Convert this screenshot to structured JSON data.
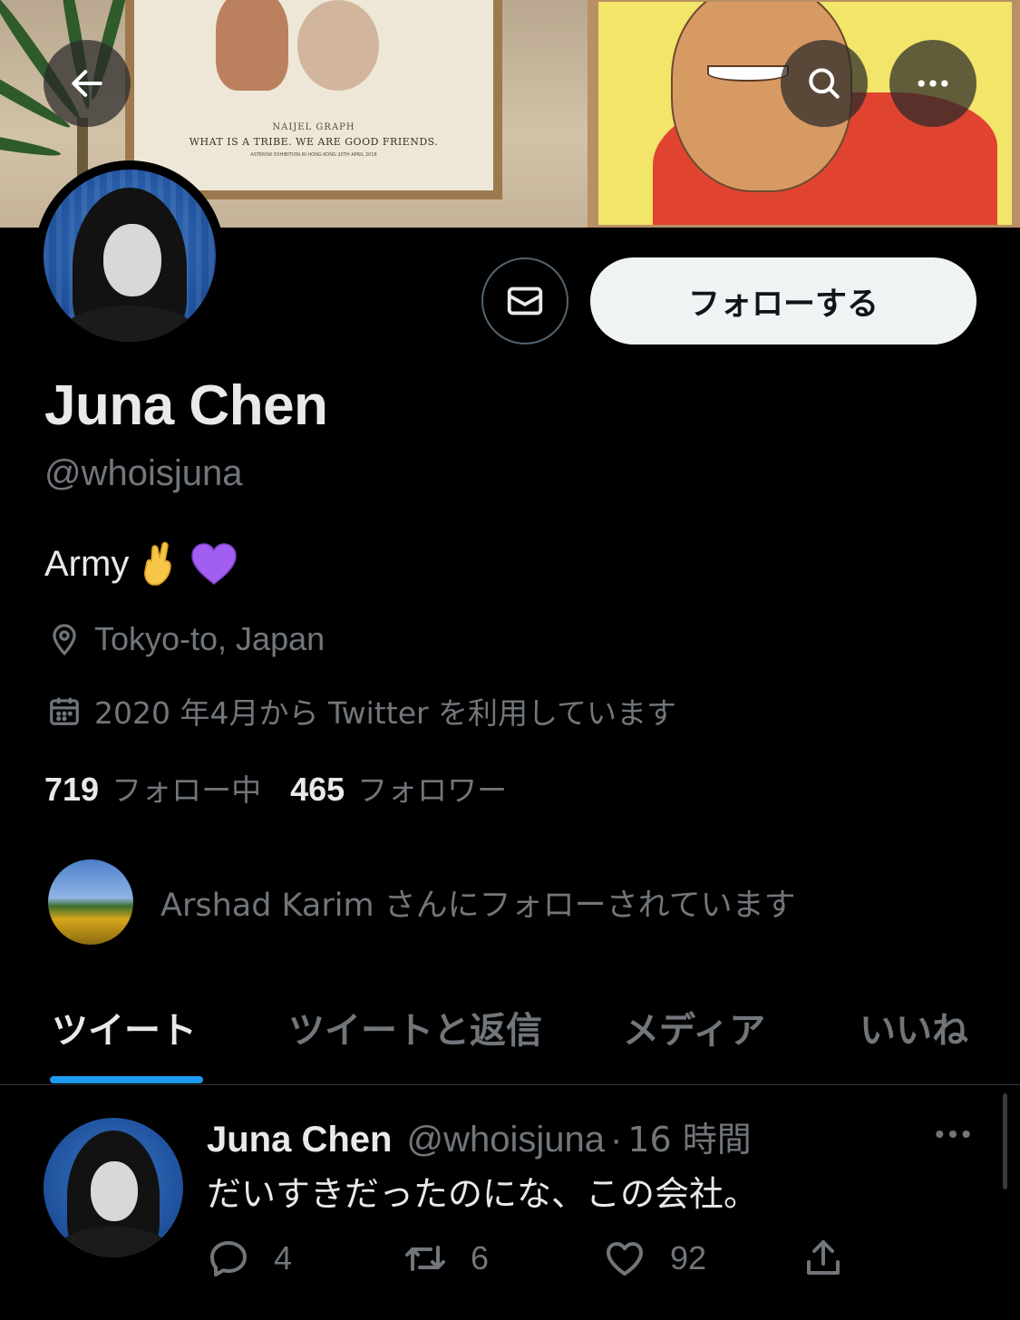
{
  "banner": {
    "artwork_caption_1": "NAIJEL GRAPH",
    "artwork_caption_2": "WHAT IS A TRIBE. WE ARE GOOD FRIENDS.",
    "artwork_caption_3": "ASTERISK EXHIBITION IN HONG KONG 20TH APRIL 2018"
  },
  "profile": {
    "name": "Juna Chen",
    "handle": "@whoisjuna",
    "bio_text": "Army",
    "location": "Tokyo-to, Japan",
    "joined": "2020 年4月から Twitter を利用しています",
    "following_count": "719",
    "following_label": "フォロー中",
    "followers_count": "465",
    "followers_label": "フォロワー",
    "followed_by": "Arshad Karim さんにフォローされています"
  },
  "actions": {
    "follow_label": "フォローする"
  },
  "tabs": [
    {
      "label": "ツイート"
    },
    {
      "label": "ツイートと返信"
    },
    {
      "label": "メディア"
    },
    {
      "label": "いいね"
    }
  ],
  "tweet": {
    "name": "Juna Chen",
    "handle": "@whoisjuna",
    "separator": "·",
    "time": "16 時間",
    "text": "だいすきだったのにな、この会社。",
    "replies": "4",
    "retweets": "6",
    "likes": "92"
  },
  "colors": {
    "background": "#000000",
    "accent": "#1d9bf0",
    "secondary_text": "#71767b",
    "primary_text": "#e7e9ea"
  }
}
